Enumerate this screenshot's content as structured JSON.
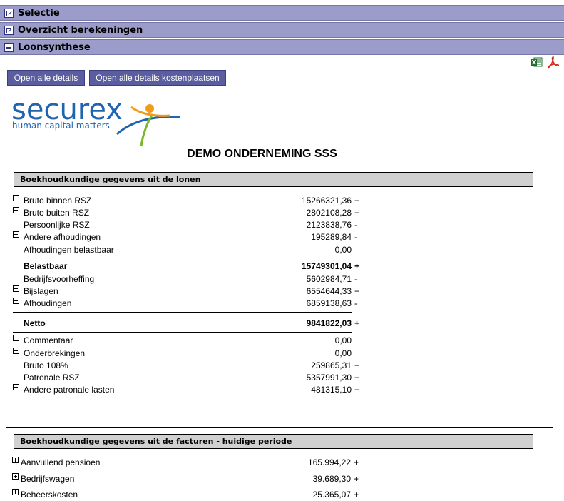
{
  "accordion": {
    "selectie": "Selectie",
    "overzicht": "Overzicht berekeningen",
    "loonsynthese": "Loonsynthese"
  },
  "toolbar": {
    "open_all": "Open alle details",
    "open_all_cost": "Open alle details kostenplaatsen"
  },
  "logo": {
    "brand": "securex",
    "tagline": "human capital matters"
  },
  "company": "DEMO ONDERNEMING SSS",
  "section1": {
    "title": "Boekhoudkundige gegevens uit de lonen",
    "rows": [
      {
        "label": "Bruto binnen RSZ",
        "value": "15266321,36",
        "sign": "+"
      },
      {
        "label": "Bruto buiten RSZ",
        "value": "2802108,28",
        "sign": "+"
      },
      {
        "label": "Persoonlijke RSZ",
        "value": "2123838,76",
        "sign": "-"
      },
      {
        "label": "Andere afhoudingen",
        "value": "195289,84",
        "sign": "-"
      },
      {
        "label": "Afhoudingen belastbaar",
        "value": "0,00",
        "sign": ""
      },
      {
        "label": "Belastbaar",
        "value": "15749301,04",
        "sign": "+"
      },
      {
        "label": "Bedrijfsvoorheffing",
        "value": "5602984,71",
        "sign": "-"
      },
      {
        "label": "Bijslagen",
        "value": "6554644,33",
        "sign": "+"
      },
      {
        "label": "Afhoudingen",
        "value": "6859138,63",
        "sign": "-"
      },
      {
        "label": "Netto",
        "value": "9841822,03",
        "sign": "+"
      },
      {
        "label": "Commentaar",
        "value": "0,00",
        "sign": ""
      },
      {
        "label": "Onderbrekingen",
        "value": "0,00",
        "sign": ""
      },
      {
        "label": "Bruto 108%",
        "value": "259865,31",
        "sign": "+"
      },
      {
        "label": "Patronale RSZ",
        "value": "5357991,30",
        "sign": "+"
      },
      {
        "label": "Andere patronale lasten",
        "value": "481315,10",
        "sign": "+"
      }
    ]
  },
  "section2": {
    "title": "Boekhoudkundige gegevens uit de facturen - huidige periode",
    "rows": [
      {
        "label": "Aanvullend pensioen",
        "value": "165.994,22",
        "sign": "+"
      },
      {
        "label": "Bedrijfswagen",
        "value": "39.689,30",
        "sign": "+"
      },
      {
        "label": "Beheerskosten",
        "value": "25.365,07",
        "sign": "+"
      }
    ]
  }
}
